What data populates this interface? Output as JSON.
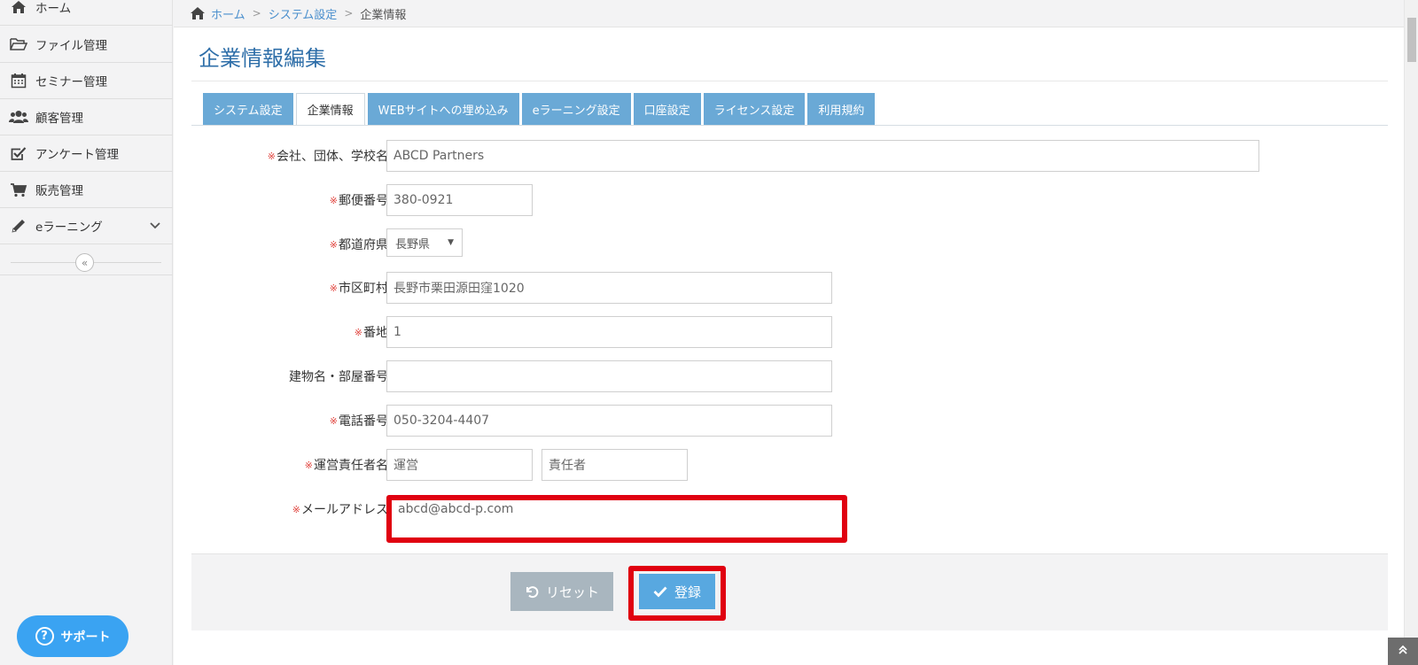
{
  "sidebar": {
    "items": [
      {
        "label": "ホーム",
        "icon": "home-icon"
      },
      {
        "label": "ファイル管理",
        "icon": "folder-open-icon"
      },
      {
        "label": "セミナー管理",
        "icon": "calendar-icon"
      },
      {
        "label": "顧客管理",
        "icon": "users-icon"
      },
      {
        "label": "アンケート管理",
        "icon": "checkbox-icon"
      },
      {
        "label": "販売管理",
        "icon": "cart-icon"
      },
      {
        "label": "eラーニング",
        "icon": "pencil-icon"
      }
    ],
    "collapse_glyph": "«",
    "support_label": "サポート",
    "support_glyph": "?"
  },
  "breadcrumb": {
    "items": [
      "ホーム",
      "システム設定",
      "企業情報"
    ],
    "separator": ">"
  },
  "page_title": "企業情報編集",
  "tabs": [
    {
      "label": "システム設定",
      "active": false
    },
    {
      "label": "企業情報",
      "active": true
    },
    {
      "label": "WEBサイトへの埋め込み",
      "active": false
    },
    {
      "label": "eラーニング設定",
      "active": false
    },
    {
      "label": "口座設定",
      "active": false
    },
    {
      "label": "ライセンス設定",
      "active": false
    },
    {
      "label": "利用規約",
      "active": false
    }
  ],
  "required_mark": "※",
  "form": {
    "company": {
      "label": "会社、団体、学校名",
      "value": "ABCD Partners"
    },
    "postal": {
      "label": "郵便番号",
      "value": "380-0921"
    },
    "prefecture": {
      "label": "都道府県",
      "value": "長野県",
      "caret": "▼"
    },
    "city": {
      "label": "市区町村",
      "value": "長野市栗田源田窪1020"
    },
    "address": {
      "label": "番地",
      "value": "1"
    },
    "building": {
      "label": "建物名・部屋番号",
      "value": ""
    },
    "phone": {
      "label": "電話番号",
      "value": "050-3204-4407"
    },
    "manager": {
      "label": "運営責任者名",
      "last_name": "運営",
      "first_name": "責任者"
    },
    "email": {
      "label": "メールアドレス",
      "value": "abcd@abcd-p.com"
    }
  },
  "buttons": {
    "reset": "リセット",
    "submit": "登録"
  },
  "colors": {
    "accent": "#2f6fa9",
    "tab": "#6aa9d6",
    "highlight": "#e00010",
    "submit": "#58a8e0",
    "reset": "#a9b6bf",
    "support": "#3aa3f2"
  }
}
